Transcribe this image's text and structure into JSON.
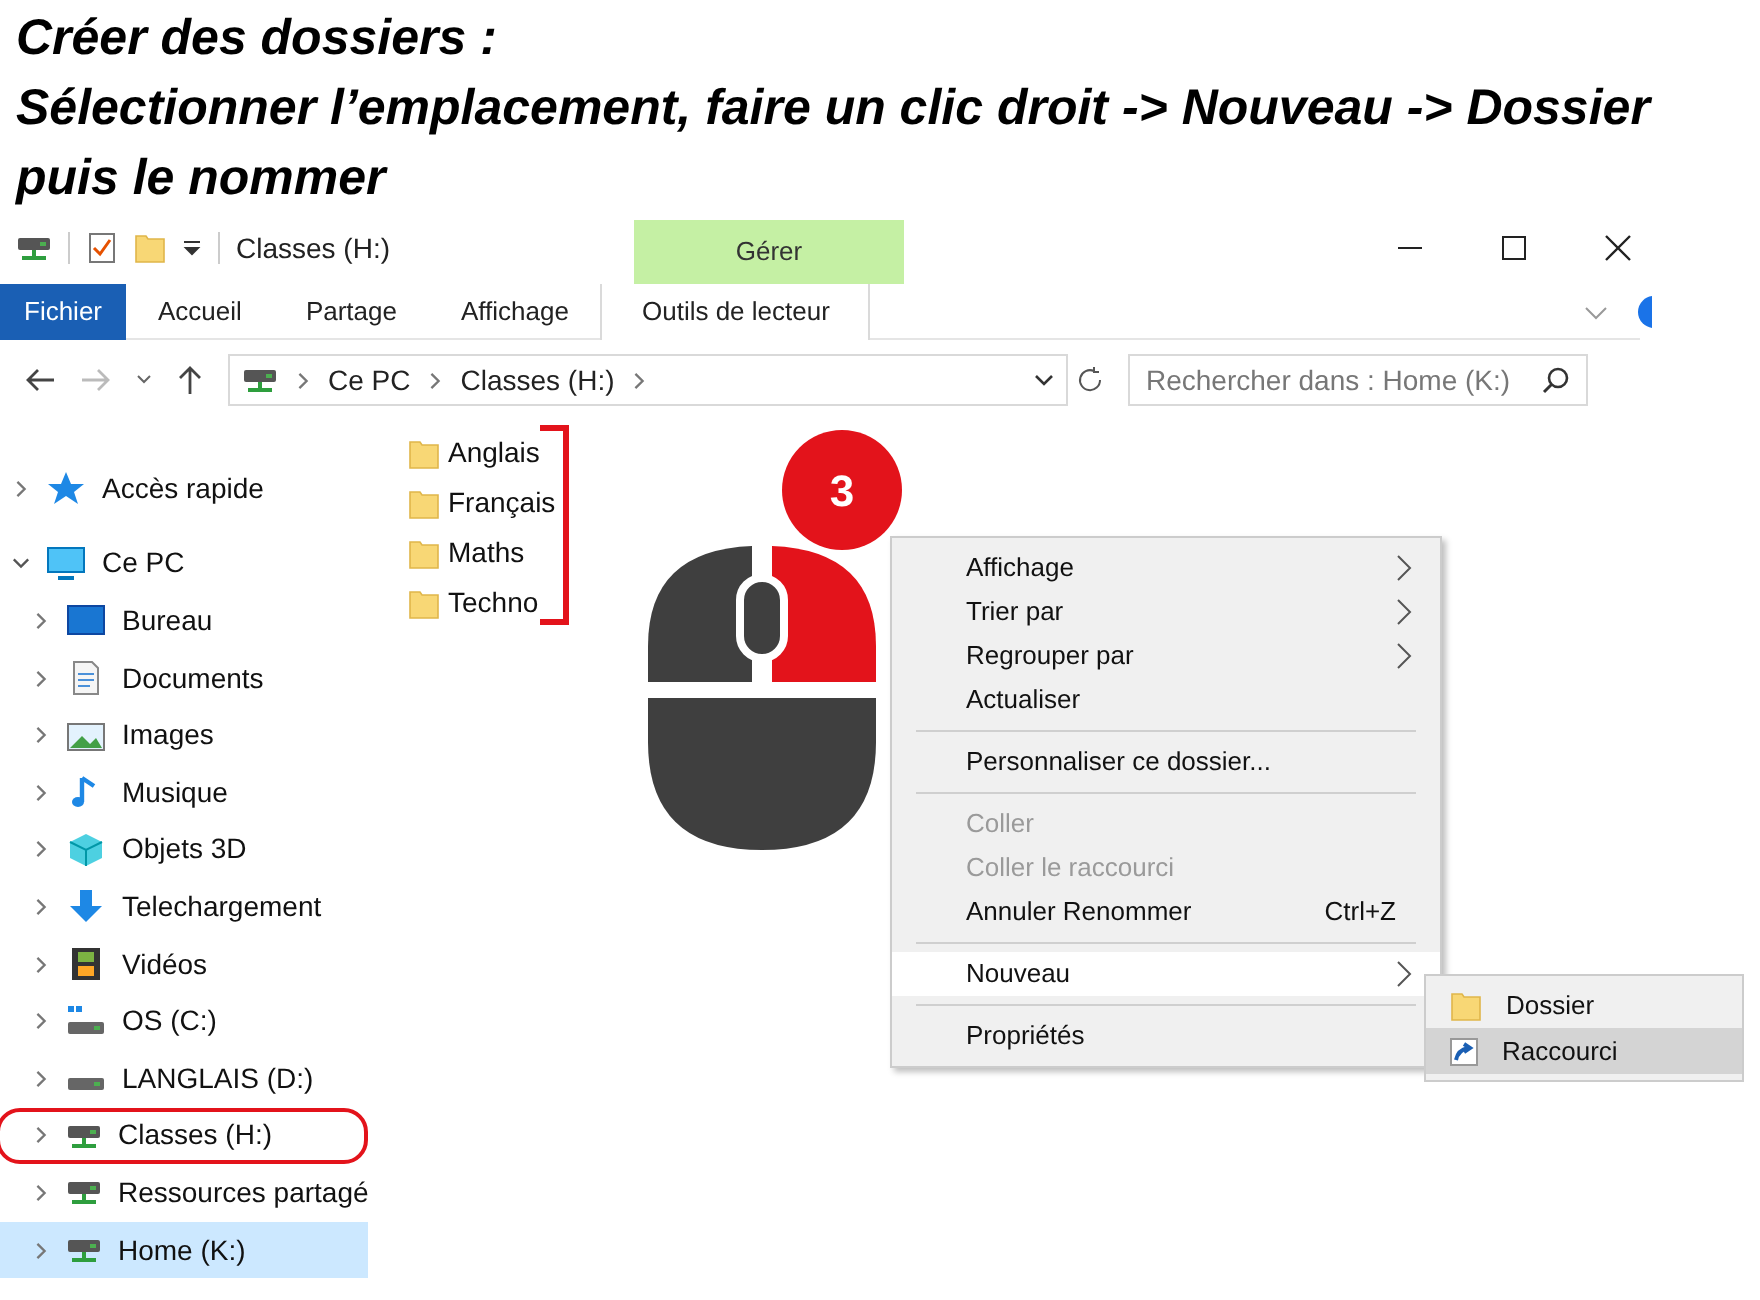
{
  "heading": [
    "Créer des dossiers :",
    "Sélectionner l’emplacement, faire un clic droit -> Nouveau -> Dossier puis le nommer"
  ],
  "window": {
    "title": "Classes (H:)",
    "context_tab_group": "Gérer"
  },
  "ribbon_tabs": [
    {
      "label": "Fichier",
      "kind": "file",
      "selected": false
    },
    {
      "label": "Accueil",
      "kind": "tab",
      "selected": false
    },
    {
      "label": "Partage",
      "kind": "tab",
      "selected": false
    },
    {
      "label": "Affichage",
      "kind": "tab",
      "selected": false
    },
    {
      "label": "Outils de lecteur",
      "kind": "context",
      "selected": false
    }
  ],
  "address_bar": {
    "path": [
      "Ce PC",
      "Classes (H:)"
    ]
  },
  "search": {
    "placeholder": "Rechercher dans : Home (K:)"
  },
  "sidebar": {
    "items": [
      {
        "label": "Accès rapide",
        "kind": "quick_access",
        "expanded": false,
        "selected": false,
        "circled": false
      },
      {
        "label": "Ce PC",
        "kind": "pc",
        "expanded": true,
        "selected": false,
        "circled": false,
        "children": [
          {
            "label": "Bureau",
            "kind": "desktop",
            "expanded": false,
            "selected": false,
            "circled": false
          },
          {
            "label": "Documents",
            "kind": "documents",
            "expanded": false,
            "selected": false,
            "circled": false
          },
          {
            "label": "Images",
            "kind": "pictures",
            "expanded": false,
            "selected": false,
            "circled": false
          },
          {
            "label": "Musique",
            "kind": "music",
            "expanded": false,
            "selected": false,
            "circled": false
          },
          {
            "label": "Objets 3D",
            "kind": "objects3d",
            "expanded": false,
            "selected": false,
            "circled": false
          },
          {
            "label": "Telechargement",
            "kind": "downloads",
            "expanded": false,
            "selected": false,
            "circled": false
          },
          {
            "label": "Vidéos",
            "kind": "videos",
            "expanded": false,
            "selected": false,
            "circled": false
          },
          {
            "label": "OS (C:)",
            "kind": "system_drive",
            "expanded": false,
            "selected": false,
            "circled": false
          },
          {
            "label": "LANGLAIS (D:)",
            "kind": "drive",
            "expanded": false,
            "selected": false,
            "circled": false
          },
          {
            "label": "Classes (H:)",
            "kind": "network_drive",
            "expanded": false,
            "selected": false,
            "circled": true
          },
          {
            "label": "Ressources partagé",
            "kind": "network_drive",
            "expanded": false,
            "selected": false,
            "circled": false
          },
          {
            "label": "Home (K:)",
            "kind": "network_drive",
            "expanded": false,
            "selected": true,
            "circled": false
          }
        ]
      }
    ]
  },
  "folders": [
    "Anglais",
    "Français",
    "Maths",
    "Techno"
  ],
  "step_badge": "3",
  "context_menu": [
    {
      "kind": "item",
      "label": "Affichage",
      "submenu": true,
      "disabled": false,
      "hovered": false
    },
    {
      "kind": "item",
      "label": "Trier par",
      "submenu": true,
      "disabled": false,
      "hovered": false
    },
    {
      "kind": "item",
      "label": "Regrouper par",
      "submenu": true,
      "disabled": false,
      "hovered": false
    },
    {
      "kind": "item",
      "label": "Actualiser",
      "submenu": false,
      "disabled": false,
      "hovered": false
    },
    {
      "kind": "separator"
    },
    {
      "kind": "item",
      "label": "Personnaliser ce dossier...",
      "submenu": false,
      "disabled": false,
      "hovered": false
    },
    {
      "kind": "separator"
    },
    {
      "kind": "item",
      "label": "Coller",
      "submenu": false,
      "disabled": true,
      "hovered": false
    },
    {
      "kind": "item",
      "label": "Coller le raccourci",
      "submenu": false,
      "disabled": true,
      "hovered": false
    },
    {
      "kind": "item",
      "label": "Annuler Renommer",
      "shortcut": "Ctrl+Z",
      "submenu": false,
      "disabled": false,
      "hovered": false
    },
    {
      "kind": "separator"
    },
    {
      "kind": "item",
      "label": "Nouveau",
      "submenu": true,
      "disabled": false,
      "hovered": true
    },
    {
      "kind": "separator"
    },
    {
      "kind": "item",
      "label": "Propriétés",
      "submenu": false,
      "disabled": false,
      "hovered": false
    }
  ],
  "submenu": [
    {
      "label": "Dossier",
      "kind": "folder",
      "hovered": false
    },
    {
      "label": "Raccourci",
      "kind": "shortcut",
      "hovered": true
    }
  ]
}
